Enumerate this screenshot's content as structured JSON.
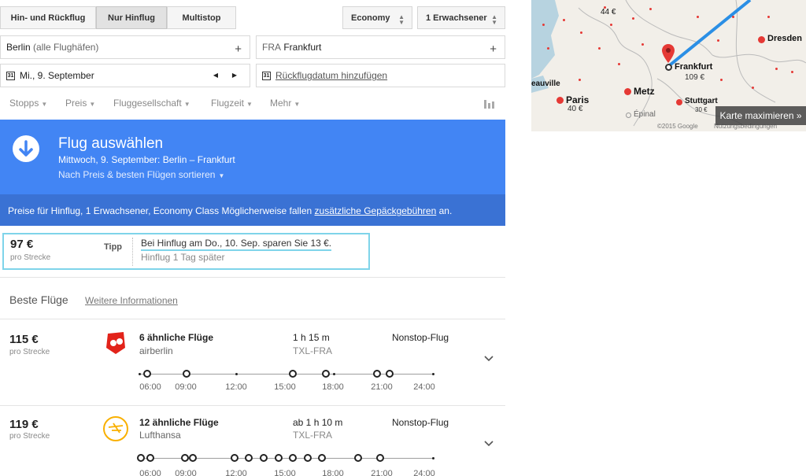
{
  "trip_type": {
    "round_trip": "Hin- und Rückflug",
    "one_way": "Nur Hinflug",
    "multi_stop": "Multistop"
  },
  "cabin": "Economy",
  "passengers": "1 Erwachsener",
  "origin": {
    "name": "Berlin",
    "suffix": "(alle Flughäfen)",
    "add": "+"
  },
  "destination": {
    "code": "FRA",
    "name": "Frankfurt",
    "add": "+"
  },
  "depart_date": "Mi., 9. September",
  "return_date_placeholder": "Rückflugdatum hinzufügen",
  "calendar_icon_label": "31",
  "filters": [
    "Stopps",
    "Preis",
    "Fluggesellschaft",
    "Flugzeit",
    "Mehr"
  ],
  "banner": {
    "title": "Flug auswählen",
    "subtitle": "Mittwoch, 9. September:  Berlin – Frankfurt",
    "sort": "Nach Preis & besten Flügen sortieren"
  },
  "info": {
    "text": "Preise für Hinflug, 1 Erwachsener, Economy Class Möglicherweise fallen",
    "link": "zusätzliche Gepäckgebühren",
    "tail": "an."
  },
  "tip": {
    "price": "97 €",
    "per": "pro Strecke",
    "label": "Tipp",
    "headline": "Bei Hinflug am Do., 10. Sep. sparen Sie 13 €.",
    "detail": "Hinflug 1 Tag später"
  },
  "best": {
    "title": "Beste Flüge",
    "more": "Weitere Informationen"
  },
  "timeline_ticks": [
    "06:00",
    "09:00",
    "12:00",
    "15:00",
    "18:00",
    "21:00",
    "24:00"
  ],
  "flights": [
    {
      "price": "115 €",
      "per": "pro Strecke",
      "similar": "6 ähnliche Flüge",
      "airline": "airberlin",
      "duration": "1 h 15 m",
      "route": "TXL-FRA",
      "stops": "Nonstop-Flug",
      "logo_color": "#e2231a"
    },
    {
      "price": "119 €",
      "per": "pro Strecke",
      "similar": "12 ähnliche Flüge",
      "airline": "Lufthansa",
      "duration": "ab 1 h 10 m",
      "route": "TXL-FRA",
      "stops": "Nonstop-Flug",
      "logo_color": "#f9b000"
    }
  ],
  "map": {
    "cities": {
      "frankfurt": "Frankfurt",
      "frankfurt_price": "109 €",
      "paris": "Paris",
      "paris_price": "40 €",
      "metz": "Metz",
      "stuttgart": "Stuttgart",
      "stuttgart_price": "30 €",
      "dresden": "Dresden",
      "epinal": "Épinal",
      "deauville": "eauville",
      "top_price": "44 €"
    },
    "copyright": "©2015 Google",
    "terms": "Nutzungsbedingungen",
    "maximize": "Karte maximieren »"
  },
  "colors": {
    "banner": "#4285f4",
    "info_bar": "#3a72d4",
    "tip_border": "#7fd4ea"
  }
}
